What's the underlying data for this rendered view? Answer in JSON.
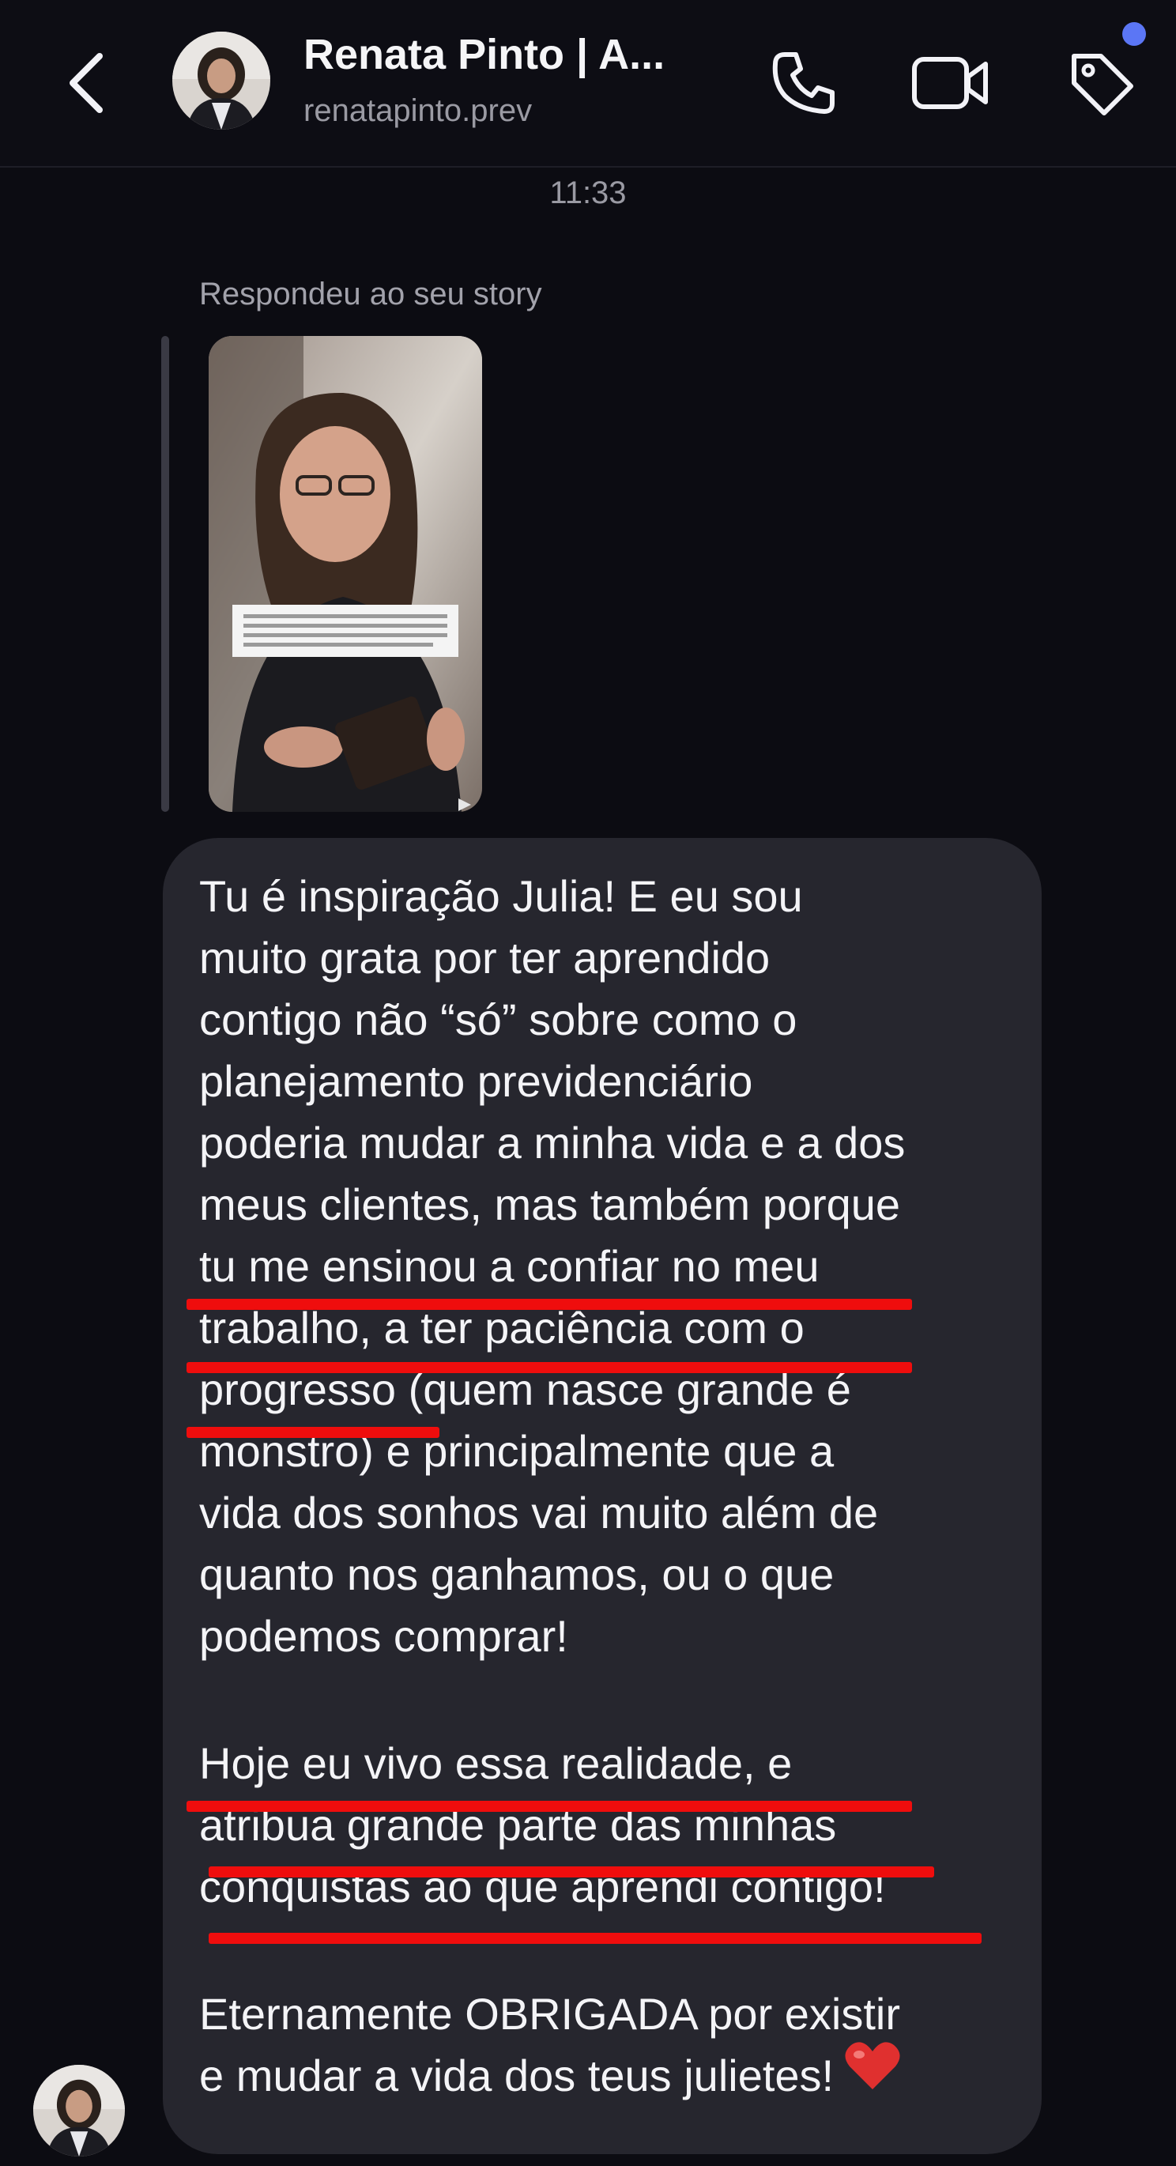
{
  "header": {
    "title": "Renata Pinto | A...",
    "subtitle": "renatapinto.prev",
    "icons": {
      "back": "back-chevron-icon",
      "call": "phone-icon",
      "video": "video-camera-icon",
      "tag": "tag-icon",
      "notification": "notification-dot"
    }
  },
  "thread": {
    "timestamp": "11:33",
    "reply_label": "Respondeu ao seu story",
    "story_thumbnail": "story-thumbnail-image",
    "message_lines": [
      "Tu é inspiração Julia! E eu sou",
      "muito grata por ter aprendido",
      "contigo não “só” sobre como o",
      "planejamento previdenciário",
      "poderia mudar a minha vida e a dos",
      "meus clientes, mas também porque",
      "tu me ensinou a confiar no meu",
      "trabalho, a ter paciência com o",
      "progresso (quem nasce grande é",
      "monstro) e principalmente que a",
      "vida dos sonhos vai muito além de",
      "quanto nos ganhamos, ou o que",
      "podemos comprar!",
      "",
      "Hoje eu vivo essa realidade, e",
      "atribua grande parte das minhas",
      "conquistas ao que aprendi contigo!",
      "",
      "Eternamente OBRIGADA por existir",
      "e mudar a vida dos teus julietes!"
    ],
    "message_emoji": "heart-emoji",
    "highlight_color": "#ef0d0d"
  },
  "colors": {
    "background": "#0c0c12",
    "bubble": "#26262e",
    "accent": "#5b76f5"
  }
}
